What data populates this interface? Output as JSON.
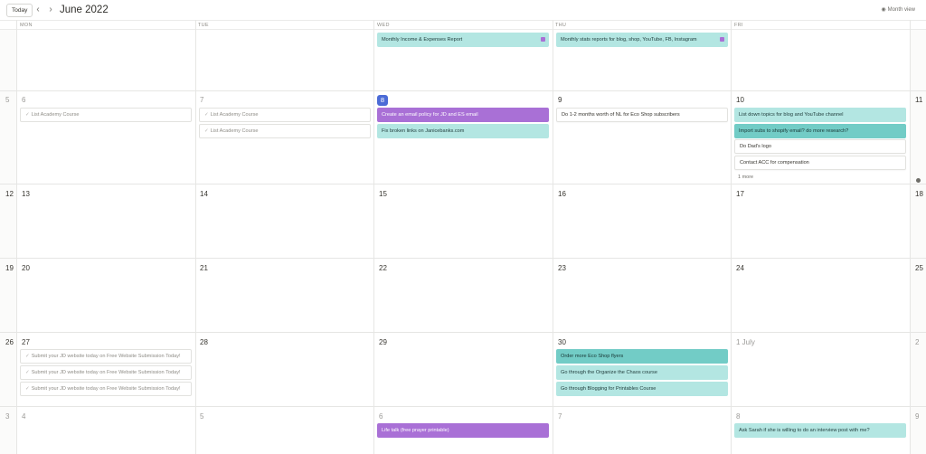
{
  "toolbar": {
    "today_label": "Today",
    "prev_icon": "chevron-left-icon",
    "next_icon": "chevron-right-icon",
    "month_title": "June 2022",
    "view_label": "Month view",
    "view_icon": "eye-icon"
  },
  "weekdays": [
    "MON",
    "TUE",
    "WED",
    "THU",
    "FRI"
  ],
  "week1": {
    "events": {
      "wed": "Monthly Income & Expenses Report",
      "thu": "Monthly stats reports for blog, shop, YouTube, FB, Instagram"
    }
  },
  "week2": {
    "days": {
      "side_left": "5",
      "mon": "6",
      "tue": "7",
      "wed": "8",
      "thu": "9",
      "fri": "10",
      "side_right": "11"
    },
    "events": {
      "mon_task": "List Academy Course",
      "tue_task1": "List Academy Course",
      "tue_task2": "List Academy Course",
      "wed_1": "Create an email policy for JD and ES email",
      "wed_2": "Fix broken links on Janicebanks.com",
      "thu_1": "Do 1-2 months worth of NL for Eco Shop subscribers",
      "fri_1": "List down topics for blog and YouTube channel",
      "fri_2": "Import subs to shopify email? do more research?",
      "fri_3": "Do Dad's logo",
      "fri_4": "Contact ACC for compensation",
      "fri_more": "1 more"
    }
  },
  "week3": {
    "days": {
      "side_left": "12",
      "mon": "13",
      "tue": "14",
      "wed": "15",
      "thu": "16",
      "fri": "17",
      "side_right": "18"
    }
  },
  "week4": {
    "days": {
      "side_left": "19",
      "mon": "20",
      "tue": "21",
      "wed": "22",
      "thu": "23",
      "fri": "24",
      "side_right": "25"
    }
  },
  "week5": {
    "days": {
      "side_left": "26",
      "mon": "27",
      "tue": "28",
      "wed": "29",
      "thu": "30",
      "fri": "1 July",
      "side_right": "2"
    },
    "events": {
      "mon_task1": "Submit your JD website today on Free Website Submission Today!",
      "mon_task2": "Submit your JD website today on Free Website Submission Today!",
      "mon_task3": "Submit your JD website today on Free Website Submission Today!",
      "thu_1": "Order more Eco Shop flyers",
      "thu_2": "Go through the Organize the Chaos course",
      "thu_3": "Go through Blogging for Printables Course"
    }
  },
  "week6": {
    "days": {
      "side_left": "3",
      "mon": "4",
      "tue": "5",
      "wed": "6",
      "thu": "7",
      "fri": "8",
      "side_right": "9"
    },
    "events": {
      "wed_1": "Life talk (free prayer printable)",
      "fri_1": "Ask Sarah if she is willing to do an interview post with me?"
    }
  },
  "colors": {
    "accent_today": "#4b6bd6",
    "event_teal": "#b3e6e2",
    "event_teal_dark": "#72ccc6",
    "event_purple": "#a970d6"
  }
}
